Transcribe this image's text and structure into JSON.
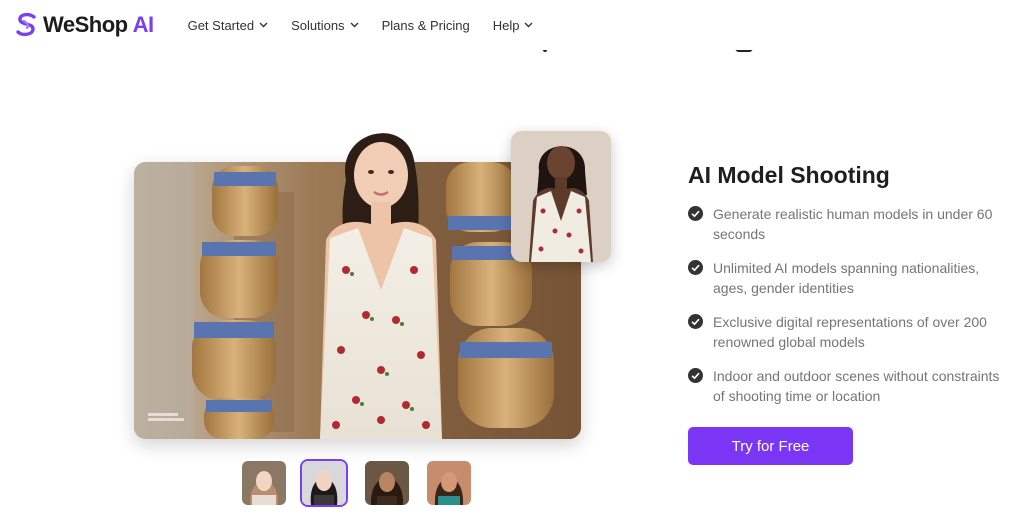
{
  "header": {
    "logo_text": "WeShop",
    "logo_accent": "AI",
    "nav": [
      {
        "label": "Get Started",
        "has_dropdown": true
      },
      {
        "label": "Solutions",
        "has_dropdown": true
      },
      {
        "label": "Plans & Pricing",
        "has_dropdown": false
      },
      {
        "label": "Help",
        "has_dropdown": true
      }
    ]
  },
  "hero": {
    "main_image_icon": "model-photo",
    "reference_image_icon": "reference-model-photo",
    "thumbnails_count": 4,
    "active_thumbnail": 1
  },
  "feature": {
    "title": "AI Model Shooting",
    "bullets": [
      "Generate realistic human models in under 60 seconds",
      "Unlimited AI models spanning nationalities, ages, gender identities",
      "Exclusive digital representations of over 200 renowned global models",
      "Indoor and outdoor scenes without constraints of shooting time or location"
    ],
    "cta_label": "Try for Free"
  },
  "colors": {
    "brand": "#7a35f5",
    "text_dark": "#1e1e1e",
    "text_muted": "#757575"
  }
}
